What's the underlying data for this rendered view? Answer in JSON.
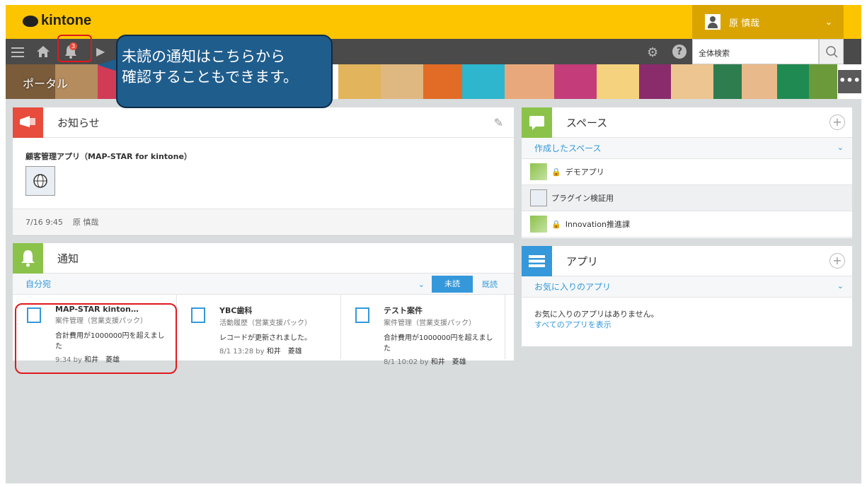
{
  "header": {
    "logo": "kintone",
    "user_name": "原 慎哉"
  },
  "toolbar": {
    "badge_count": "3",
    "search_placeholder": "全体検索"
  },
  "banner": {
    "title": "ポータル"
  },
  "callout": {
    "line1": "未読の通知はこちらから",
    "line2": "確認することもできます。"
  },
  "notices": {
    "title": "お知らせ",
    "app_name": "顧客管理アプリ（MAP-STAR for kintone）",
    "footer_time": "7/16 9:45",
    "footer_user": "原 慎哉"
  },
  "notifications": {
    "title": "通知",
    "filter": "自分宛",
    "tab_unread": "未読",
    "tab_read": "既読",
    "items": [
      {
        "title": "MAP-STAR kinton…",
        "app": "案件管理（営業支援パック）",
        "message": "合計費用が1000000円を超えました",
        "time": "9:34",
        "by": "by",
        "user": "和井　菱雄"
      },
      {
        "title": "YBC歯科",
        "app": "活動履歴（営業支援パック）",
        "message": "レコードが更新されました。",
        "time": "8/1 13:28",
        "by": "by",
        "user": "和井　菱雄"
      },
      {
        "title": "テスト案件",
        "app": "案件管理（営業支援パック）",
        "message": "合計費用が1000000円を超えました",
        "time": "8/1 10:02",
        "by": "by",
        "user": "和井　菱雄"
      }
    ]
  },
  "spaces": {
    "title": "スペース",
    "filter": "作成したスペース",
    "items": [
      {
        "name": "デモアプリ",
        "locked": true
      },
      {
        "name": "プラグイン検証用",
        "locked": false
      },
      {
        "name": "Innovation推進課",
        "locked": true
      }
    ]
  },
  "apps": {
    "title": "アプリ",
    "filter": "お気に入りのアプリ",
    "empty_message": "お気に入りのアプリはありません。",
    "show_all_link": "すべてのアプリを表示"
  },
  "colors": {
    "header_yellow": "#fdc500",
    "accent_blue": "#3498db",
    "notice_red": "#e74c3c",
    "notify_green": "#8bc34a",
    "callout_blue": "#1f5d8d",
    "highlight_red": "#e0191f"
  }
}
